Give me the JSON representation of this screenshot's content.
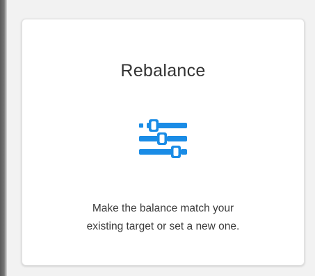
{
  "card": {
    "title": "Rebalance",
    "icon": "sliders-icon",
    "description_line1": "Make the balance match your",
    "description_line2": "existing target or set a new one."
  },
  "colors": {
    "accent": "#1a8ce6",
    "background": "#f2f2f2",
    "card": "#ffffff",
    "text": "#333333"
  }
}
